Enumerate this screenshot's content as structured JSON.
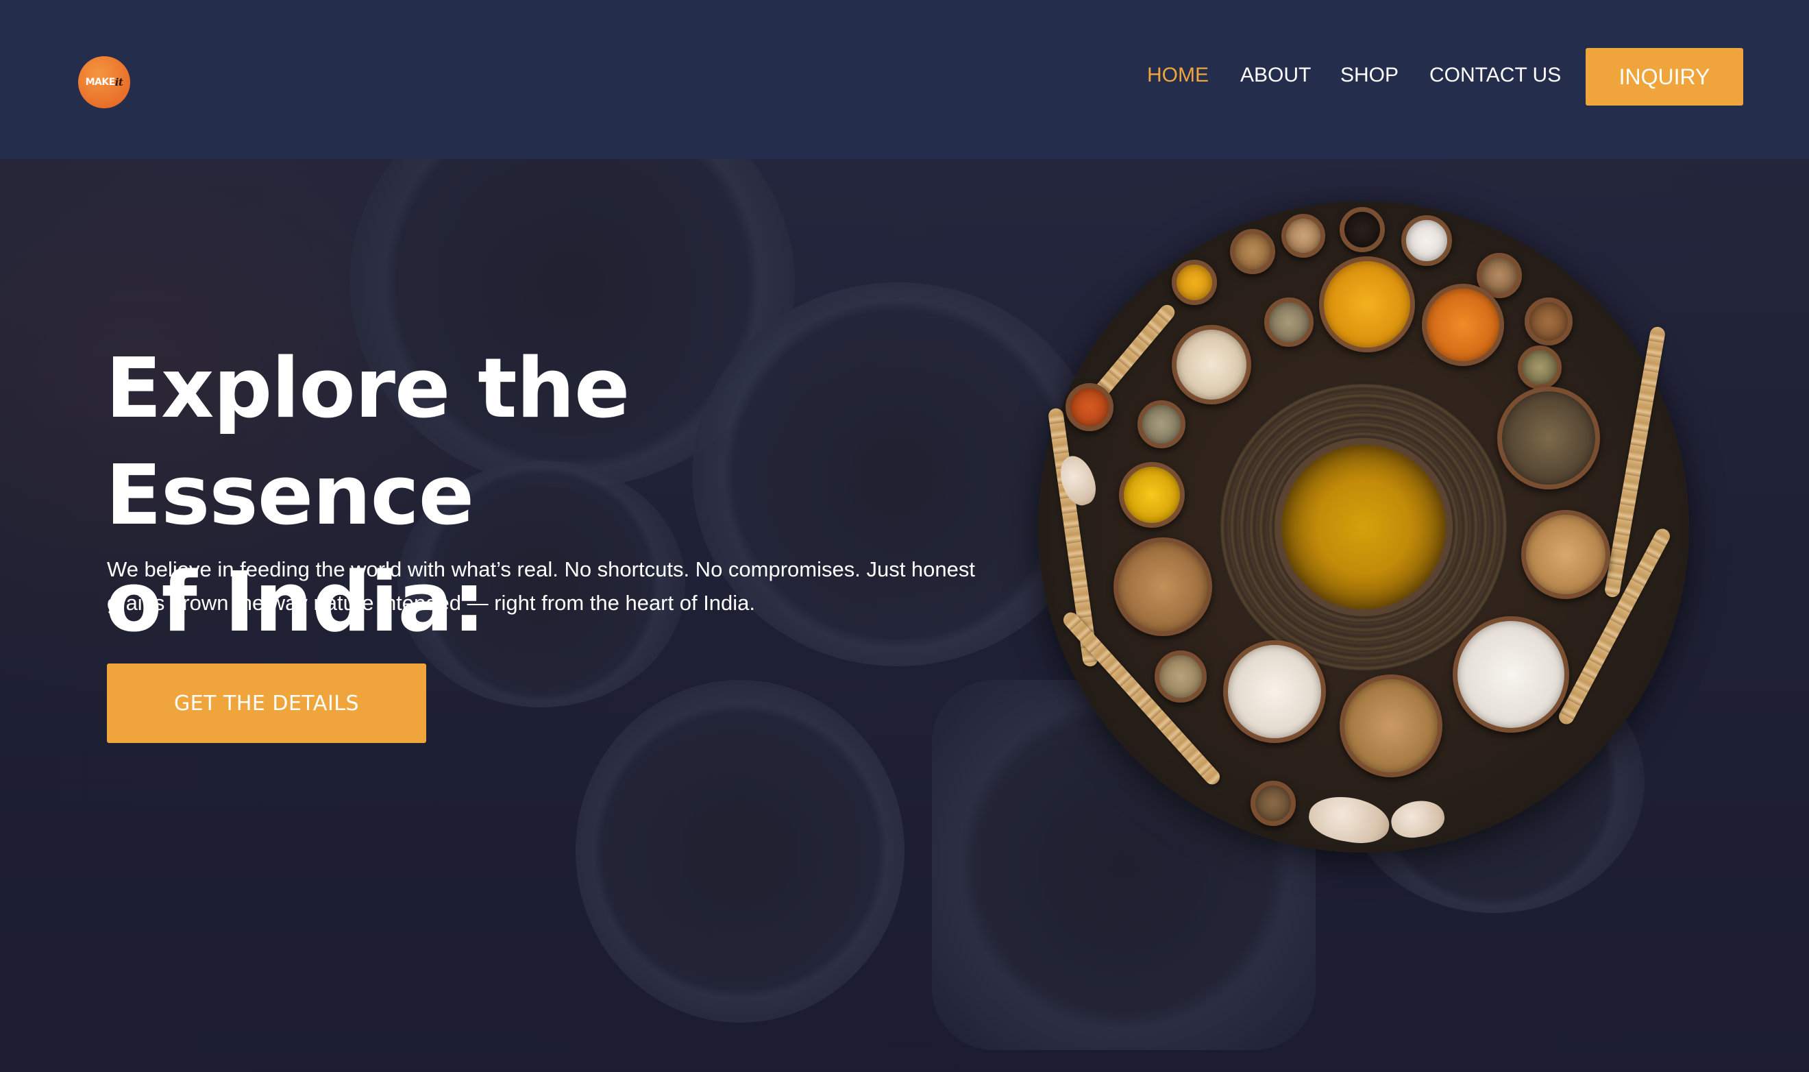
{
  "brand": {
    "logo_text": "MAKE",
    "logo_suffix": "it"
  },
  "nav": {
    "items": [
      {
        "label": "HOME",
        "active": true
      },
      {
        "label": "ABOUT",
        "active": false
      },
      {
        "label": "SHOP",
        "active": false
      },
      {
        "label": "CONTACT US",
        "active": false
      }
    ],
    "inquiry_label": "INQUIRY"
  },
  "hero": {
    "title_line1": "Explore the Essence",
    "title_line2": "of India:",
    "description": "We believe in feeding the world with what’s real. No shortcuts. No compromises. Just honest grains grown the way nature intended — right from the heart of India.",
    "cta_label": "GET THE DETAILS"
  },
  "colors": {
    "accent": "#f0a53c",
    "navbar_bg": "#252d4d",
    "hero_bg": "#1d2036",
    "logo": "#ee7a2e"
  },
  "images": {
    "hero_image": "indian-spice-platter"
  }
}
